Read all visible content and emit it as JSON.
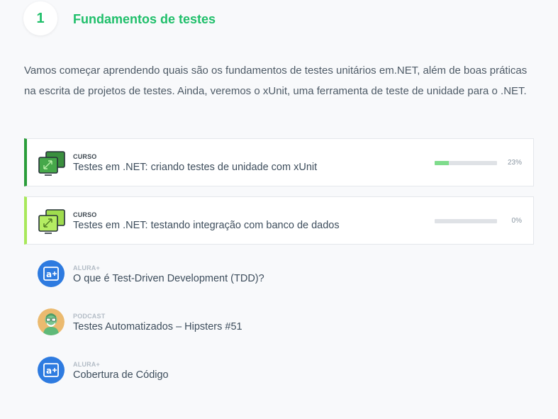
{
  "step": {
    "number": "1",
    "title": "Fundamentos de testes"
  },
  "description": "Vamos começar aprendendo quais são os fundamentos de testes unitários em.NET, além de boas práticas na escrita de projetos de testes. Ainda, veremos o xUnit, uma ferramenta de teste de unidade para o .NET.",
  "courses": [
    {
      "type": "CURSO",
      "title": "Testes em .NET: criando testes de unidade com xUnit",
      "progress_label": "23%",
      "progress": 0.23,
      "accent_color": "#2a9d3a",
      "icon": "course-screens-icon"
    },
    {
      "type": "CURSO",
      "title": "Testes em .NET: testando integração com banco de dados",
      "progress_label": "0%",
      "progress": 0,
      "accent_color": "#a8e85a",
      "icon": "course-screens-icon"
    }
  ],
  "extras": [
    {
      "type": "ALURA+",
      "title": "O que é Test-Driven Development (TDD)?",
      "icon": "alura-plus-icon",
      "color": "#2e7be0"
    },
    {
      "type": "PODCAST",
      "title": "Testes Automatizados – Hipsters #51",
      "icon": "podcast-avatar-icon",
      "color": "#e9b96e"
    },
    {
      "type": "ALURA+",
      "title": "Cobertura de Código",
      "icon": "alura-plus-icon",
      "color": "#2e7be0"
    }
  ]
}
